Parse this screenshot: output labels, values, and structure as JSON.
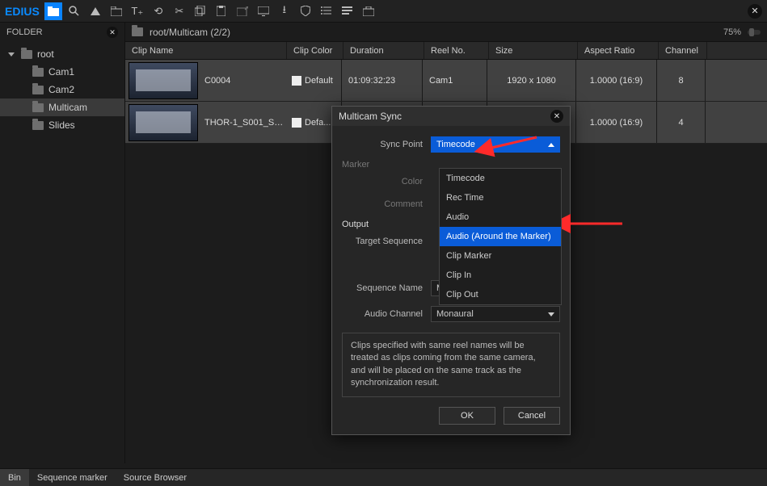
{
  "titlebar": {
    "logo": "EDIUS"
  },
  "sidebar": {
    "header": "FOLDER",
    "root": "root",
    "items": [
      "Cam1",
      "Cam2",
      "Multicam",
      "Slides"
    ],
    "selected_index": 2
  },
  "breadcrumb": {
    "path": "root/Multicam (2/2)",
    "zoom": "75%"
  },
  "columns": {
    "name": "Clip Name",
    "color": "Clip Color",
    "duration": "Duration",
    "reel": "Reel No.",
    "size": "Size",
    "aspect": "Aspect Ratio",
    "channel": "Channel"
  },
  "rows": [
    {
      "name": "C0004",
      "color": "Default",
      "duration": "01:09:32:23",
      "reel": "Cam1",
      "size": "1920 x 1080",
      "aspect": "1.0000 (16:9)",
      "channel": "8"
    },
    {
      "name": "THOR-1_S001_S0...",
      "color": "Defa...",
      "duration": "",
      "reel": "",
      "size": "",
      "aspect": "1.0000 (16:9)",
      "channel": "4"
    }
  ],
  "dialog": {
    "title": "Multicam Sync",
    "labels": {
      "sync_point": "Sync Point",
      "marker": "Marker",
      "marker_color": "Color",
      "marker_comment": "Comment",
      "output": "Output",
      "target_sequence": "Target Sequence",
      "sequence_name": "Sequence Name",
      "audio_channel": "Audio Channel"
    },
    "values": {
      "sync_point": "Timecode",
      "sequence_name": "Multicam1",
      "audio_channel": "Monaural"
    },
    "dropdown_items": [
      "Timecode",
      "Rec Time",
      "Audio",
      "Audio (Around the Marker)",
      "Clip Marker",
      "Clip In",
      "Clip Out"
    ],
    "highlight_index": 3,
    "info": "Clips specified with same reel names will be treated as clips coming from the same camera, and will be placed on the same track as the synchronization result.",
    "buttons": {
      "ok": "OK",
      "cancel": "Cancel"
    }
  },
  "bottombar": {
    "tabs": [
      "Bin",
      "Sequence marker",
      "Source Browser"
    ],
    "active_index": 0
  }
}
